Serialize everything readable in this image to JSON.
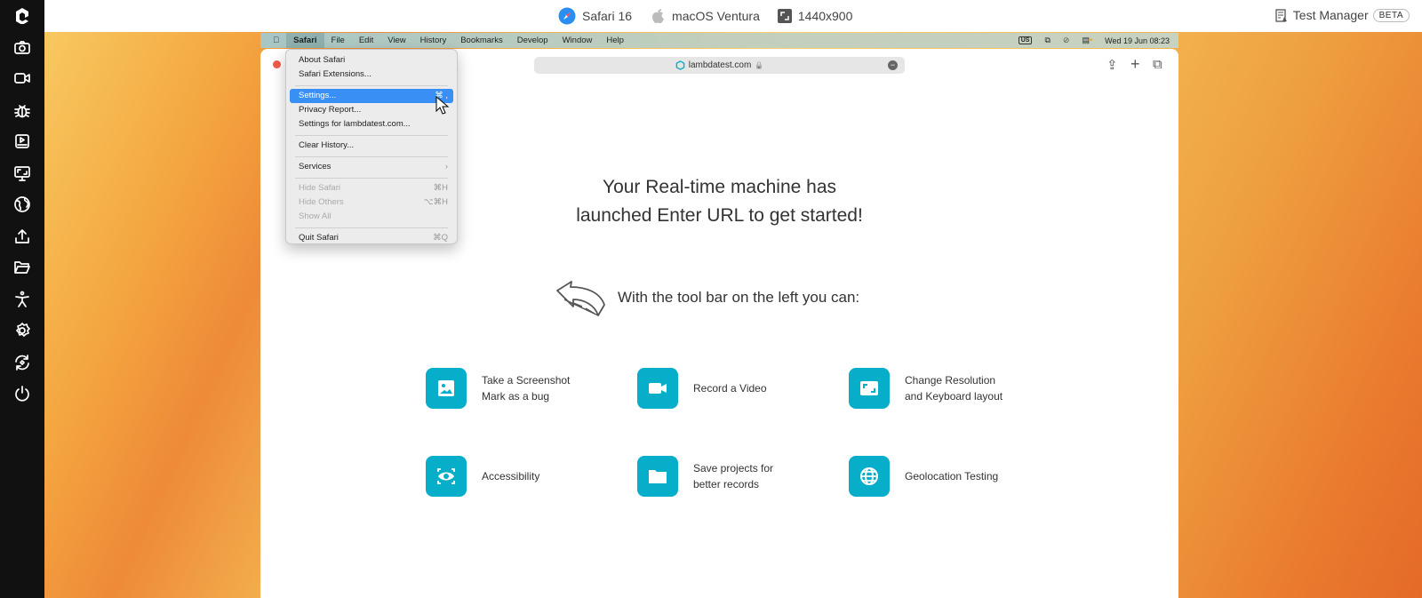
{
  "sidebar": {
    "items": [
      {
        "icon": "lambdatest-logo-icon"
      },
      {
        "icon": "camera-icon"
      },
      {
        "icon": "video-icon"
      },
      {
        "icon": "bug-icon"
      },
      {
        "icon": "media-player-icon"
      },
      {
        "icon": "resolution-monitor-icon"
      },
      {
        "icon": "globe-icon"
      },
      {
        "icon": "upload-icon"
      },
      {
        "icon": "folder-icon"
      },
      {
        "icon": "accessibility-icon"
      },
      {
        "icon": "settings-gear-icon"
      },
      {
        "icon": "switch-session-icon"
      },
      {
        "icon": "power-icon"
      }
    ]
  },
  "topbar": {
    "browser": "Safari 16",
    "os": "macOS Ventura",
    "resolution": "1440x900",
    "test_manager": "Test Manager",
    "beta": "BETA"
  },
  "mac_menubar": {
    "items": [
      "Safari",
      "File",
      "Edit",
      "View",
      "History",
      "Bookmarks",
      "Develop",
      "Window",
      "Help"
    ],
    "keyboard": "US",
    "datetime": "Wed 19 Jun  08:23"
  },
  "safari": {
    "url": "lambdatest.com",
    "lock": "🔒"
  },
  "safari_menu": [
    {
      "label": "About Safari",
      "shortcut": ""
    },
    {
      "label": "Safari Extensions...",
      "shortcut": ""
    },
    {
      "sep": true
    },
    {
      "label": "Settings...",
      "shortcut": "⌘ ,",
      "highlight": true
    },
    {
      "label": "Privacy Report...",
      "shortcut": ""
    },
    {
      "label": "Settings for lambdatest.com...",
      "shortcut": ""
    },
    {
      "sep": true
    },
    {
      "label": "Clear History...",
      "shortcut": ""
    },
    {
      "sep": true
    },
    {
      "label": "Services",
      "shortcut": "›"
    },
    {
      "sep": true
    },
    {
      "label": "Hide Safari",
      "shortcut": "⌘H",
      "disabled": true
    },
    {
      "label": "Hide Others",
      "shortcut": "⌥⌘H",
      "disabled": true
    },
    {
      "label": "Show All",
      "shortcut": "",
      "disabled": true
    },
    {
      "sep": true
    },
    {
      "label": "Quit Safari",
      "shortcut": "⌘Q"
    }
  ],
  "content": {
    "headline_1": "Your Real-time machine has",
    "headline_2": "launched Enter URL to get started!",
    "subtitle": "With the tool bar on the left you can:",
    "features": [
      {
        "icon": "screenshot-icon",
        "line1": "Take a Screenshot",
        "line2": "Mark as a bug"
      },
      {
        "icon": "video-icon",
        "line1": "Record a Video",
        "line2": ""
      },
      {
        "icon": "resolution-icon",
        "line1": "Change Resolution",
        "line2": "and Keyboard layout"
      },
      {
        "icon": "eye-icon",
        "line1": "Accessibility",
        "line2": ""
      },
      {
        "icon": "folder-icon",
        "line1": "Save projects for",
        "line2": "better records"
      },
      {
        "icon": "globe-icon",
        "line1": "Geolocation Testing",
        "line2": ""
      }
    ]
  },
  "colors": {
    "accent": "#06aec9",
    "menu_highlight": "#3a8ff5",
    "sidebar": "#111111"
  }
}
